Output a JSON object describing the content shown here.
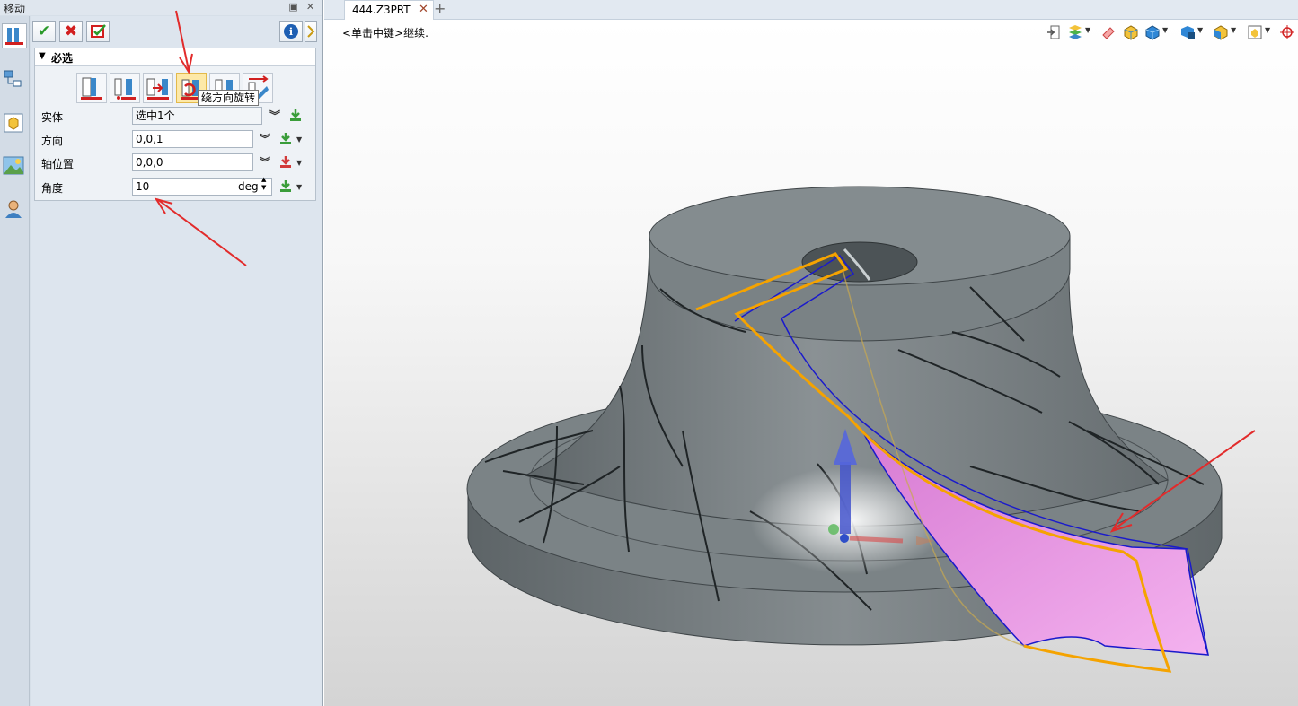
{
  "panel": {
    "title": "移动",
    "pin_icon": "pin-icon",
    "close_icon": "close-icon",
    "toolbar": {
      "ok_icon": "check-icon",
      "cancel_icon": "x-icon",
      "apply_icon": "apply-icon",
      "info_icon": "info-icon"
    },
    "section_title": "必选",
    "tooltip": "绕方向旋转",
    "fields": [
      {
        "label": "实体",
        "value": "选中1个"
      },
      {
        "label": "方向",
        "value": "0,0,1"
      },
      {
        "label": "轴位置",
        "value": "0,0,0"
      },
      {
        "label": "角度",
        "value": "10",
        "unit": "deg"
      }
    ]
  },
  "document": {
    "tab_label": "444.Z3PRT",
    "tab_close": "✕",
    "add_tab": "+",
    "prompt": "<单击中键>继续."
  },
  "colors": {
    "panel_bg": "#d6dfe8",
    "model_gray": "#7d8588",
    "highlight_orange": "#f5a300",
    "preview_pink": "#e79ae0",
    "annotation_red": "#e22b2b"
  }
}
